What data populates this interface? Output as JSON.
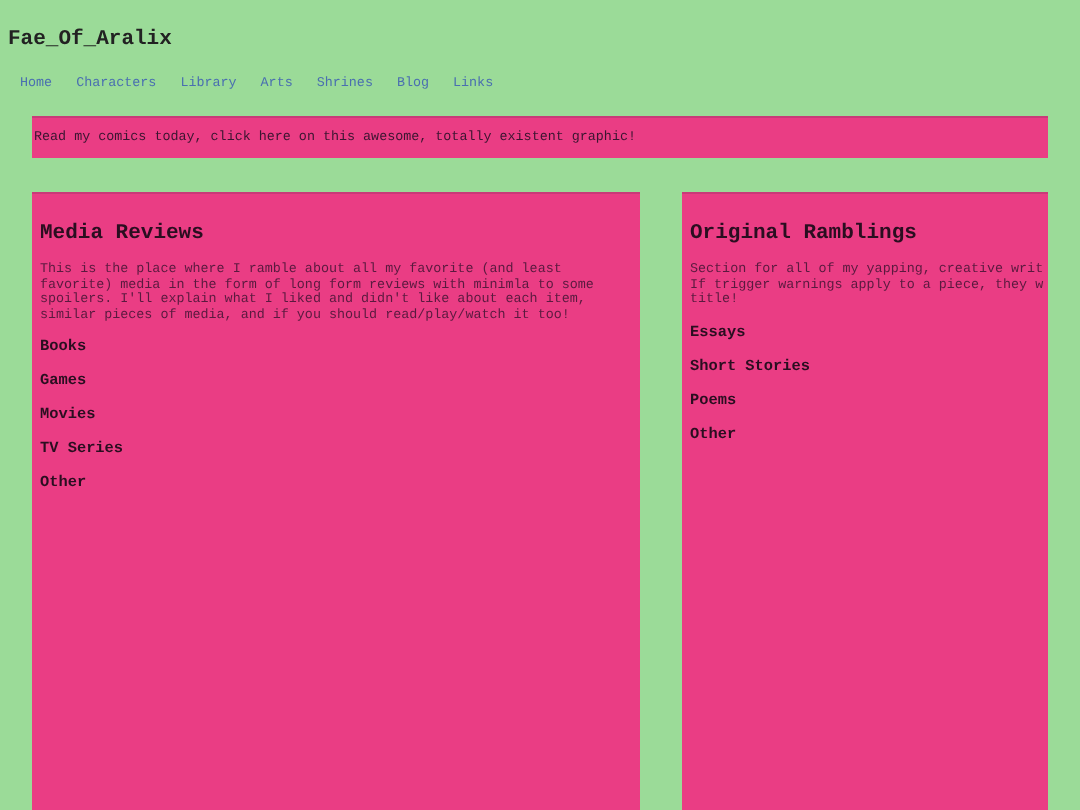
{
  "site_title": "Fae_Of_Aralix",
  "nav": [
    "Home",
    "Characters",
    "Library",
    "Arts",
    "Shrines",
    "Blog",
    "Links"
  ],
  "banner": "Read my comics today, click here on this awesome, totally existent graphic!",
  "panels": [
    {
      "title": "Media Reviews",
      "description": "This is the place where I ramble about all my favorite (and least\nfavorite) media in the form of long form reviews with minimla to some\nspoilers. I'll explain what I liked and didn't like about each item,\nsimilar pieces of media, and if you should read/play/watch it too!",
      "links": [
        "Books",
        "Games",
        "Movies",
        "TV Series",
        "Other"
      ]
    },
    {
      "title": "Original Ramblings",
      "description": "Section for all of my yapping, creative writ\nIf trigger warnings apply to a piece, they w\ntitle!",
      "links": [
        "Essays",
        "Short Stories",
        "Poems",
        "Other"
      ]
    }
  ]
}
